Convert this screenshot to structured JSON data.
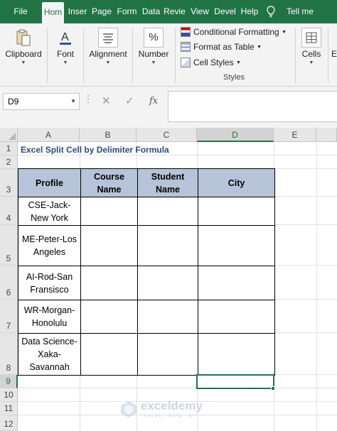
{
  "ribbon_tabs": [
    {
      "id": "file",
      "label": "File"
    },
    {
      "id": "home",
      "label": "Hom"
    },
    {
      "id": "insert",
      "label": "Inser"
    },
    {
      "id": "page",
      "label": "Page"
    },
    {
      "id": "form",
      "label": "Form"
    },
    {
      "id": "data",
      "label": "Data"
    },
    {
      "id": "review",
      "label": "Revie"
    },
    {
      "id": "view",
      "label": "View"
    },
    {
      "id": "devel",
      "label": "Devel"
    },
    {
      "id": "help",
      "label": "Help"
    },
    {
      "id": "tell",
      "label": "Tell me"
    }
  ],
  "active_tab": "Hom",
  "ribbon": {
    "clipboard": "Clipboard",
    "font": "Font",
    "alignment": "Alignment",
    "number": "Number",
    "number_icon": "%",
    "conditional_formatting": "Conditional Formatting",
    "format_as_table": "Format as Table",
    "cell_styles": "Cell Styles",
    "styles_group": "Styles",
    "cells": "Cells",
    "cut_off_group": "E"
  },
  "icons": {
    "clipboard": "clipboard-icon",
    "font": "font-a-icon",
    "alignment": "align-lines-icon",
    "number": "percent-icon",
    "cells": "cells-icon",
    "lightbulb": "lightbulb-icon"
  },
  "formula_bar": {
    "name_box": "D9",
    "cancel": "✕",
    "enter": "✓",
    "fx": "fx",
    "content": ""
  },
  "columns": [
    "A",
    "B",
    "C",
    "D",
    "E"
  ],
  "selected_column": "D",
  "rows": [
    "1",
    "2",
    "3",
    "4",
    "5",
    "6",
    "7",
    "8",
    "9",
    "10",
    "11",
    "12"
  ],
  "selected_row": "9",
  "sheet": {
    "title": "Excel Split Cell by Delimiter Formula",
    "headers": [
      "Profile",
      "Course Name",
      "Student Name",
      "City"
    ],
    "profiles": [
      "CSE-Jack-New York",
      "ME-Peter-Los Angeles",
      "AI-Rod-San Fransisco",
      "WR-Morgan-Honolulu",
      "Data Science-Xaka-Savannah"
    ]
  },
  "watermark": {
    "name": "exceldemy",
    "tagline": "EXCEL · DATA · BI"
  },
  "colors": {
    "ribbon_green": "#217346",
    "table_header_fill": "#b7c3d8",
    "title_text": "#2e4a79"
  }
}
